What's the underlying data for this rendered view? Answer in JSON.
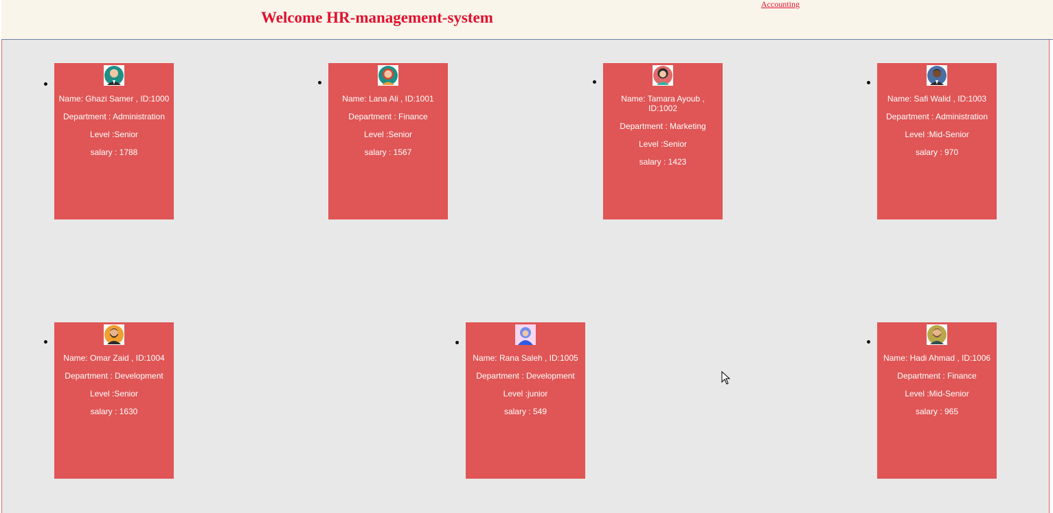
{
  "header": {
    "title": "Welcome HR-management-system",
    "nav_link": "Accounting"
  },
  "colors": {
    "title": "#e0102e",
    "card_bg": "#e05555",
    "main_bg": "#e8e8e8",
    "header_bg": "#f9f5ea"
  },
  "employees": [
    {
      "avatar_icon": "avatar-old-man-icon",
      "name_line": "Name: Ghazi Samer , ID:1000",
      "department_line": "Department : Administration",
      "level_line": "Level :Senior",
      "salary_line": "salary : 1788"
    },
    {
      "avatar_icon": "avatar-woman-red-hair-icon",
      "name_line": "Name: Lana Ali , ID:1001",
      "department_line": "Department : Finance",
      "level_line": "Level :Senior",
      "salary_line": "salary : 1567"
    },
    {
      "avatar_icon": "avatar-woman-dark-hair-icon",
      "name_line": "Name: Tamara Ayoub , ID:1002",
      "department_line": "Department : Marketing",
      "level_line": "Level :Senior",
      "salary_line": "salary : 1423"
    },
    {
      "avatar_icon": "avatar-man-suit-icon",
      "name_line": "Name: Safi Walid , ID:1003",
      "department_line": "Department : Administration",
      "level_line": "Level :Mid-Senior",
      "salary_line": "salary : 970"
    },
    {
      "avatar_icon": "avatar-man-beard-icon",
      "name_line": "Name: Omar Zaid , ID:1004",
      "department_line": "Department : Development",
      "level_line": "Level :Senior",
      "salary_line": "salary : 1630"
    },
    {
      "avatar_icon": "avatar-woman-hijab-icon",
      "name_line": "Name: Rana Saleh , ID:1005",
      "department_line": "Department : Development",
      "level_line": "Level :junior",
      "salary_line": "salary : 549"
    },
    {
      "avatar_icon": "avatar-man-glasses-icon",
      "name_line": "Name: Hadi Ahmad , ID:1006",
      "department_line": "Department : Finance",
      "level_line": "Level :Mid-Senior",
      "salary_line": "salary : 965"
    }
  ]
}
